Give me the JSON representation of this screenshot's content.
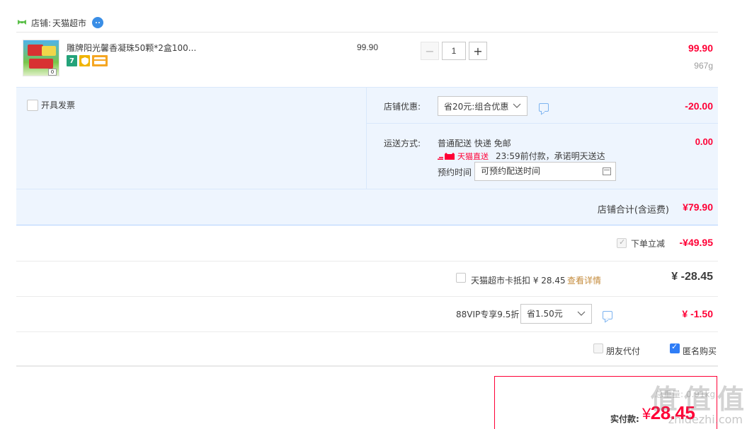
{
  "shop": {
    "prefix": "店铺:",
    "name": "天猫超市"
  },
  "item": {
    "title": "雕牌阳光馨香凝珠50颗*2盒100...",
    "thumbnail_badge": "0",
    "unit_price": "99.90",
    "quantity": "1",
    "minus_symbol": "−",
    "plus_symbol": "+",
    "line_total": "99.90",
    "weight": "967g",
    "badge_seven": "7"
  },
  "invoice": {
    "label": "开具发票"
  },
  "coupon": {
    "label": "店铺优惠:",
    "selected": "省20元:组合优惠",
    "amount": "-20.00"
  },
  "shipping": {
    "label": "运送方式:",
    "method": "普通配送 快递 免邮",
    "tmall_direct": "天猫直送",
    "note": "23:59前付款，承诺明天送达",
    "fee": "0.00",
    "appointment_label": "预约时间",
    "appointment_value": "可预约配送时间"
  },
  "subtotal": {
    "label": "店铺合计(含运费)",
    "amount": "¥79.90"
  },
  "instant_discount": {
    "label": "下单立减",
    "amount": "-¥49.95"
  },
  "tmall_card": {
    "label": "天猫超市卡抵扣 ¥ 28.45",
    "link": "查看详情",
    "amount": "¥ -28.45"
  },
  "vip": {
    "label": "88VIP专享9.5折",
    "selected": "省1.50元",
    "amount": "¥ -1.50"
  },
  "options": {
    "friend_pay": "朋友代付",
    "anonymous": "匿名购买"
  },
  "payment": {
    "weight": "总重量: 0.91kg",
    "label": "实付款:",
    "currency": "¥",
    "amount": "28.45"
  },
  "watermark": {
    "logo": "值 值 值",
    "url": "zhidezhi.com"
  },
  "colors": {
    "accent": "#ff0036",
    "panel": "#eef5fe",
    "link": "#c48b3b",
    "check_blue": "#2f7df6"
  }
}
